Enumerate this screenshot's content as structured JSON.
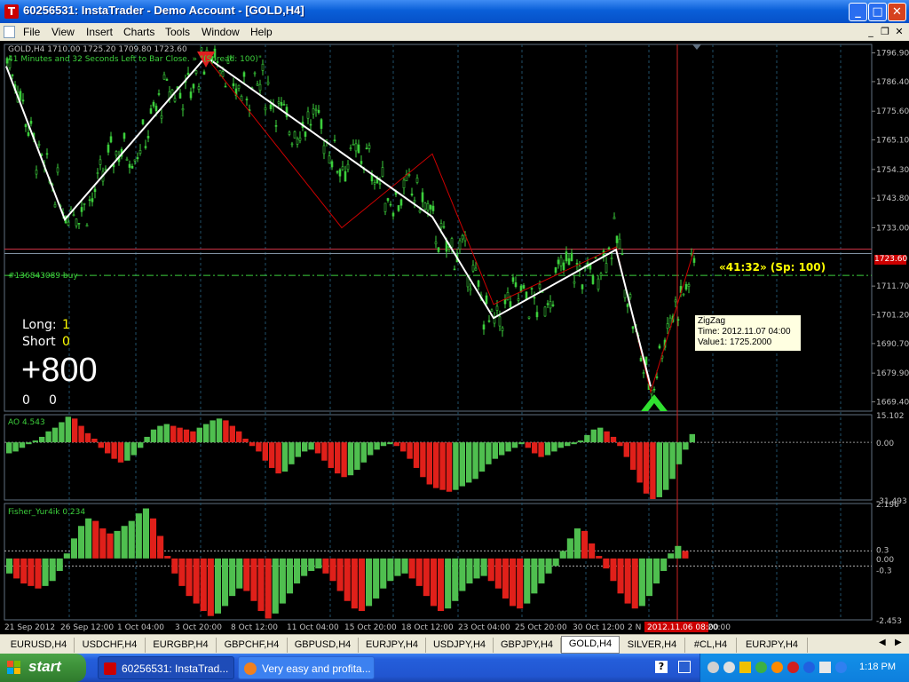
{
  "window": {
    "title": "60256531: InstaTrader - Demo Account - [GOLD,H4]",
    "icon": "instatrader-app-icon",
    "minimize": "_",
    "maximize": "□",
    "close": "✕"
  },
  "menu": {
    "items": [
      "File",
      "View",
      "Insert",
      "Charts",
      "Tools",
      "Window",
      "Help"
    ],
    "doc_minimize": "_",
    "doc_restore": "❐",
    "doc_close": "✕"
  },
  "chart": {
    "symbol_line": "GOLD,H4  1710.00 1725.20 1709.80 1723.60",
    "timer_line": "41 Minutes and 32 Seconds Left to Bar Close. »  \"(Spread: 100)\"",
    "order_label": "#136843089 buy",
    "countdown": "«41:32» (Sp: 100)",
    "current_price": "1723.60",
    "long_label": "Long:",
    "long_value": "1",
    "short_label": "Short",
    "short_value": "0",
    "profit": "+800",
    "counter_left": "0",
    "counter_right": "0",
    "price_ticks": [
      "1796.90",
      "1786.40",
      "1775.60",
      "1765.10",
      "1754.30",
      "1743.80",
      "1733.00",
      "1711.70",
      "1701.20",
      "1690.70",
      "1679.90",
      "1669.40"
    ],
    "date_ticks": [
      "21 Sep 2012",
      "26 Sep 12:00",
      "1 Oct 04:00",
      "3 Oct 20:00",
      "8 Oct 12:00",
      "11 Oct 04:00",
      "15 Oct 20:00",
      "18 Oct 12:00",
      "23 Oct 04:00",
      "25 Oct 20:00",
      "30 Oct 12:00",
      "2 N",
      "20:00"
    ],
    "cursor_date": "2012.11.06 08:00",
    "tooltip": {
      "line1": "ZigZag",
      "line2": "Time: 2012.11.07 04:00",
      "line3": "Value1: 1725.2000"
    },
    "colors": {
      "background": "#000000",
      "candle": "#3ccf3c",
      "zigzag": "#ffffff",
      "zigzag_red": "#cc0000",
      "hist_up": "#4fbf4f",
      "hist_down": "#e0201a",
      "text": "#ffffff",
      "accent_yellow": "#ffff00"
    }
  },
  "ao": {
    "label": "AO 4.543",
    "ticks": [
      "15.102",
      "0.00",
      "-31.493"
    ]
  },
  "fisher": {
    "label": "Fisher_Yur4ik 0.234",
    "ticks": [
      "2.196",
      "0.3",
      "0.00",
      "-0.3",
      "-2.453"
    ]
  },
  "tabs": [
    "EURUSD,H4",
    "USDCHF,H4",
    "EURGBP,H4",
    "GBPCHF,H4",
    "GBPUSD,H4",
    "EURJPY,H4",
    "USDJPY,H4",
    "GBPJPY,H4",
    "GOLD,H4",
    "SILVER,H4",
    "#CL,H4",
    "EURJPY,H4"
  ],
  "active_tab": "GOLD,H4",
  "taskbar": {
    "start": "start",
    "buttons": [
      "60256531: InstaTrad...",
      "Very easy and profita..."
    ],
    "clock": "1:18 PM"
  },
  "chart_data": [
    {
      "type": "line",
      "title": "GOLD,H4",
      "series": [
        {
          "name": "ZigZag",
          "x": [
            "21 Sep 2012",
            "26 Sep 12:00",
            "3 Oct 20:00",
            "18 Oct 12:00",
            "23 Oct 04:00",
            "30 Oct 12:00",
            "2 N",
            "2012.11.07 04:00"
          ],
          "values": [
            1792.0,
            1736.0,
            1795.5,
            1737.0,
            1700.0,
            1725.0,
            1675.0,
            1725.2
          ]
        }
      ],
      "ylim": [
        1666,
        1800
      ]
    },
    {
      "type": "bar",
      "title": "AO 4.543",
      "values": [
        -6,
        -5,
        -3,
        -1,
        1,
        3,
        6,
        8,
        11,
        14,
        13,
        9,
        5,
        2,
        -3,
        -6,
        -9,
        -11,
        -10,
        -7,
        -3,
        3,
        7,
        9,
        10,
        9,
        8,
        7,
        6,
        8,
        10,
        12,
        13,
        12,
        9,
        6,
        2,
        -2,
        -5,
        -10,
        -14,
        -17,
        -16,
        -12,
        -8,
        -5,
        -4,
        -6,
        -10,
        -14,
        -17,
        -19,
        -18,
        -15,
        -11,
        -7,
        -4,
        -2,
        -1,
        -2,
        -5,
        -9,
        -14,
        -19,
        -23,
        -25,
        -26,
        -27,
        -26,
        -24,
        -22,
        -20,
        -16,
        -12,
        -9,
        -7,
        -5,
        -3,
        -1,
        -3,
        -6,
        -8,
        -7,
        -5,
        -3,
        -2,
        -1,
        1,
        4,
        7,
        8,
        6,
        3,
        -2,
        -8,
        -15,
        -22,
        -28,
        -31,
        -30,
        -26,
        -20,
        -12,
        -4,
        4.5
      ],
      "ylim": [
        -31.493,
        15.102
      ]
    },
    {
      "type": "bar",
      "title": "Fisher_Yur4ik 0.234",
      "values": [
        -0.6,
        -0.8,
        -1.0,
        -1.1,
        -1.2,
        -1.1,
        -0.9,
        -0.5,
        0.2,
        0.8,
        1.3,
        1.6,
        1.5,
        1.2,
        1.0,
        1.1,
        1.3,
        1.5,
        1.8,
        2.0,
        1.6,
        0.9,
        0.1,
        -0.6,
        -1.1,
        -1.5,
        -1.8,
        -2.1,
        -2.3,
        -2.2,
        -1.9,
        -1.5,
        -1.2,
        -1.3,
        -1.7,
        -2.1,
        -2.4,
        -2.2,
        -1.8,
        -1.4,
        -1.0,
        -0.7,
        -0.5,
        -0.4,
        -0.6,
        -0.9,
        -1.3,
        -1.7,
        -2.0,
        -2.1,
        -1.9,
        -1.6,
        -1.2,
        -0.9,
        -0.7,
        -0.6,
        -0.8,
        -1.1,
        -1.5,
        -1.9,
        -2.1,
        -2.0,
        -1.7,
        -1.3,
        -1.0,
        -0.8,
        -0.7,
        -0.9,
        -1.2,
        -1.6,
        -1.9,
        -2.0,
        -1.8,
        -1.4,
        -1.0,
        -0.6,
        -0.3,
        0.3,
        0.8,
        1.2,
        1.1,
        0.6,
        0.1,
        -0.4,
        -0.9,
        -1.4,
        -1.8,
        -2.0,
        -1.9,
        -1.5,
        -1.0,
        -0.5,
        0.2,
        0.5,
        0.3
      ],
      "ylim": [
        -2.453,
        2.196
      ]
    }
  ]
}
